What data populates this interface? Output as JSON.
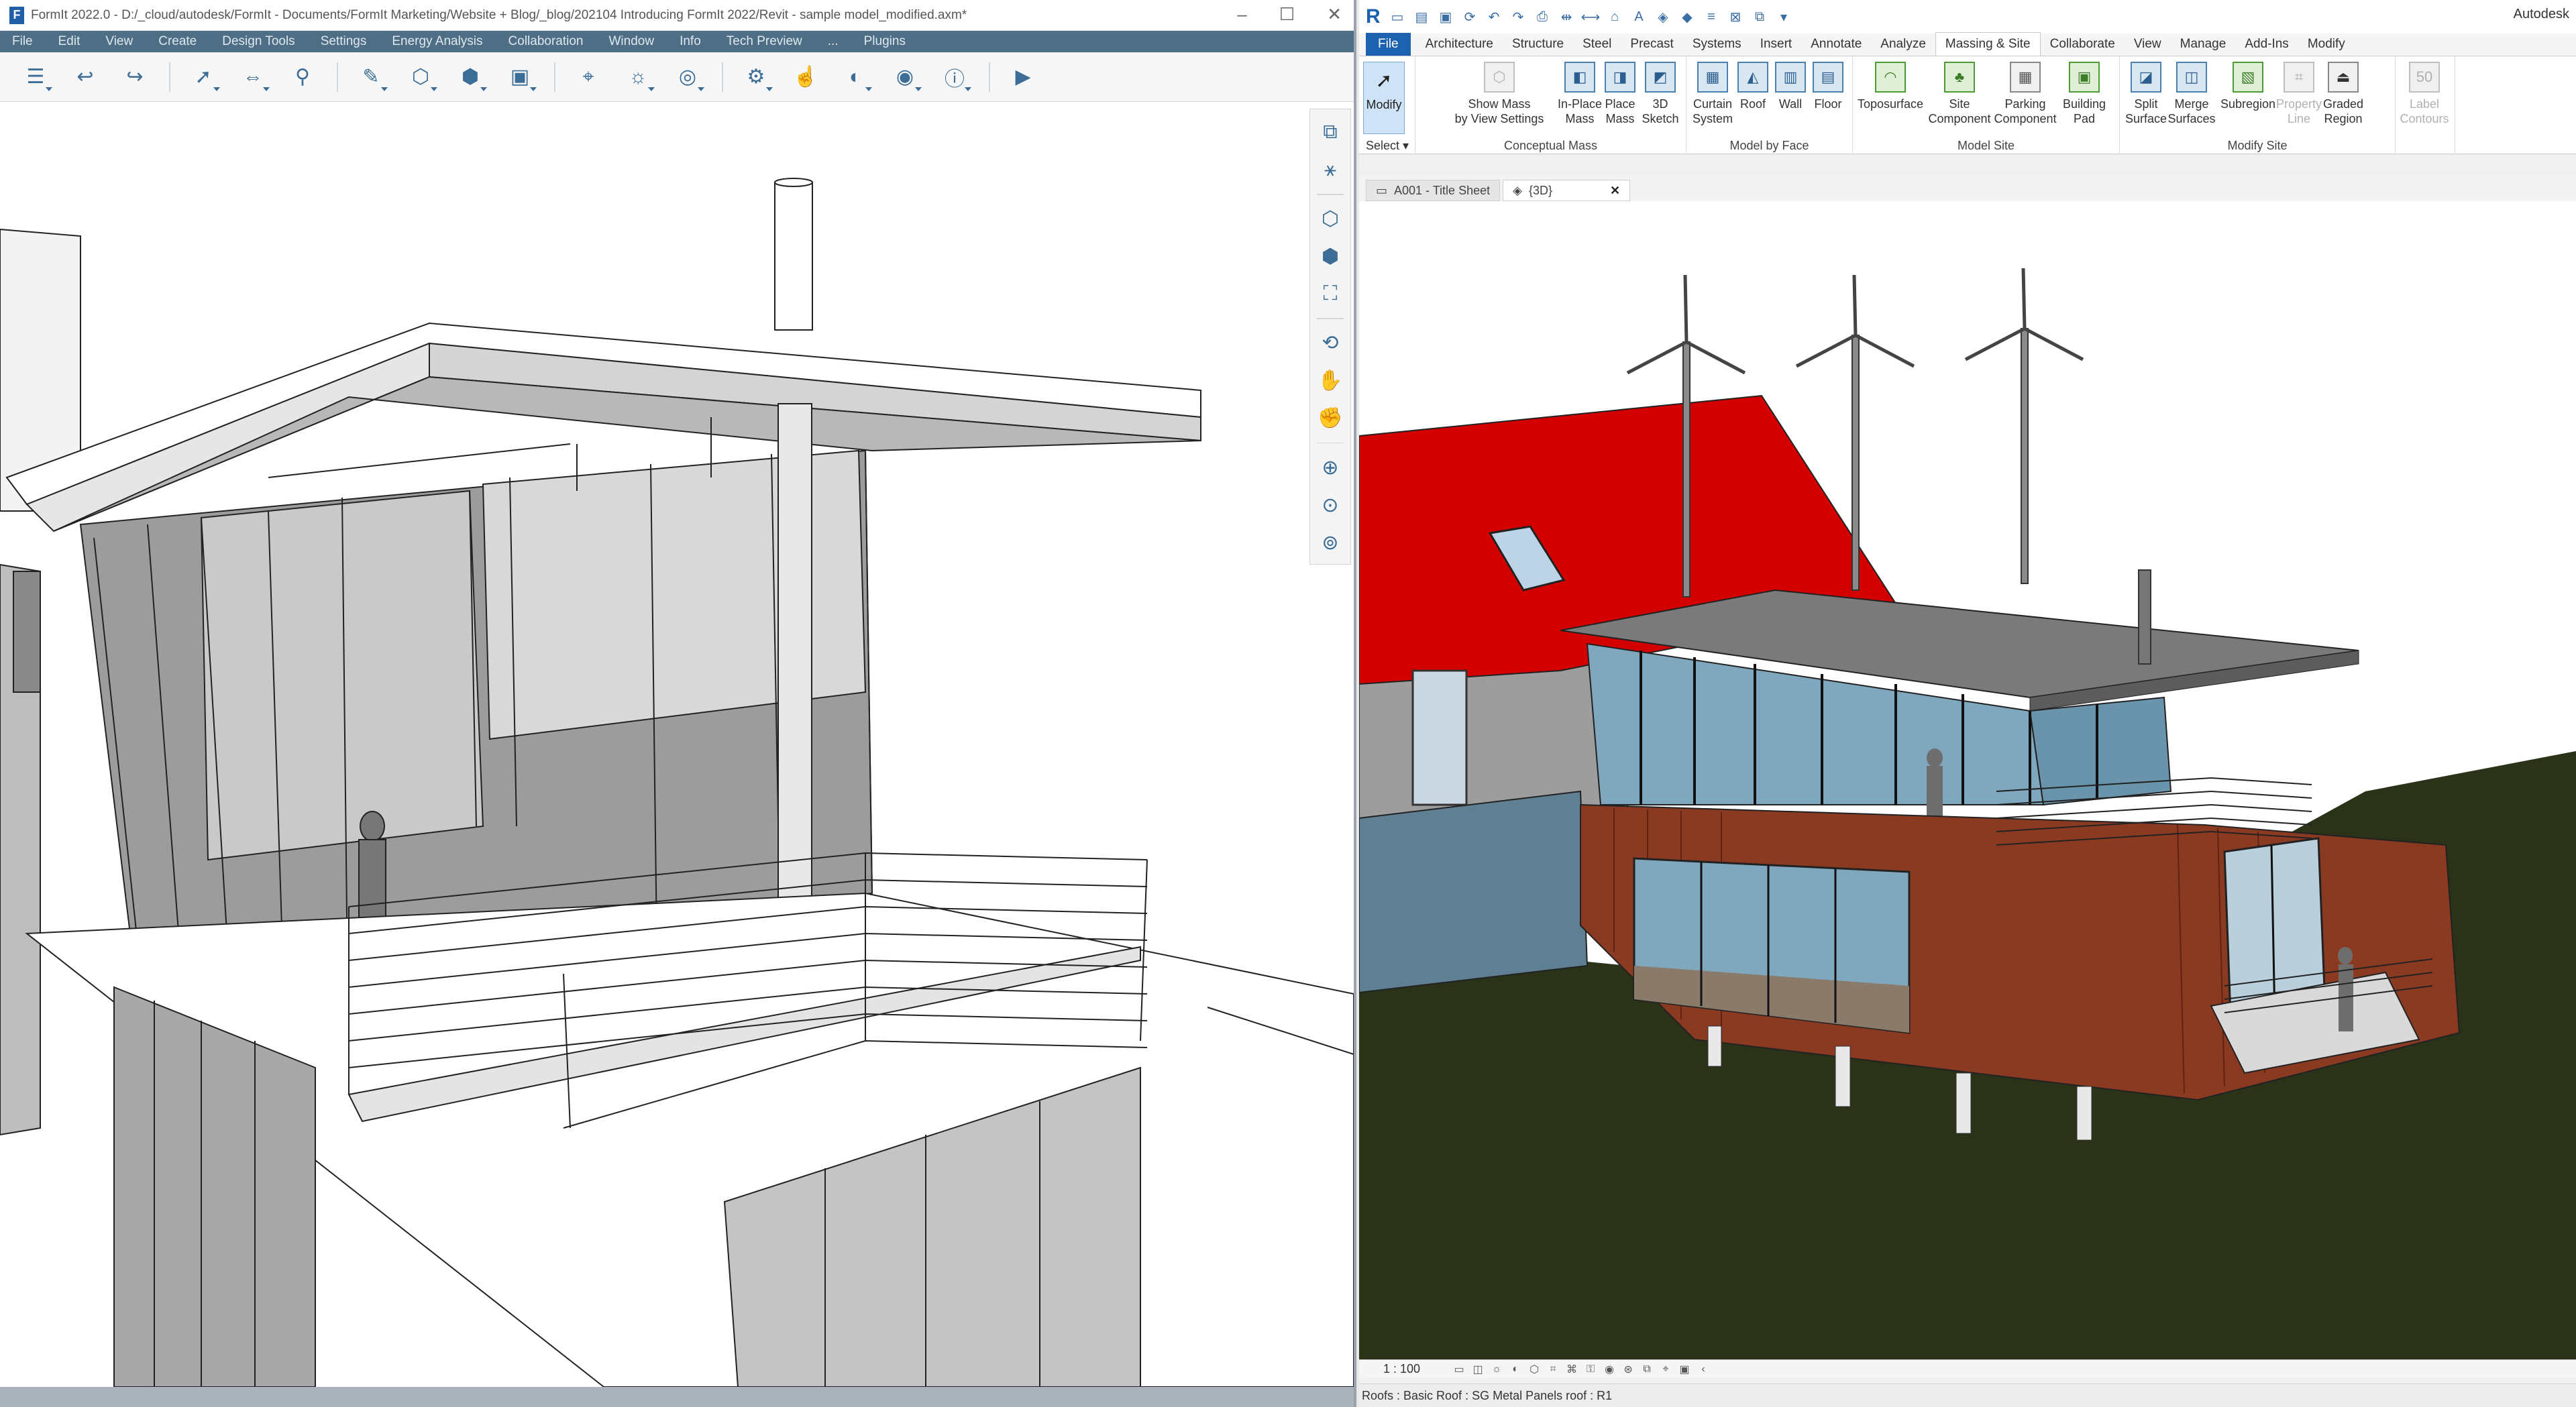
{
  "formit": {
    "title": "FormIt 2022.0 - D:/_cloud/autodesk/FormIt - Documents/FormIt Marketing/Website + Blog/_blog/202104 Introducing FormIt 2022/Revit - sample model_modified.axm*",
    "logo": "F",
    "window_controls": [
      "–",
      "☐",
      "✕"
    ],
    "menu": [
      "File",
      "Edit",
      "View",
      "Create",
      "Design Tools",
      "Settings",
      "Energy Analysis",
      "Collaboration",
      "Window",
      "Info",
      "Tech Preview",
      "...",
      "Plugins"
    ],
    "toolbar_icons": [
      "layers-icon",
      "undo-icon",
      "redo-icon",
      "select-icon",
      "measure-icon",
      "paint-icon",
      "sketch-icon",
      "cube-icon",
      "model-icon",
      "group-icon",
      "location-icon",
      "sun-icon",
      "scale-icon",
      "settings-icon",
      "touch-icon",
      "share-icon",
      "account-icon",
      "info-icon",
      "revit-icon"
    ],
    "nav_icons": [
      "layer-stack-icon",
      "axes-icon",
      "iso-view-icon",
      "top-view-icon",
      "front-view-icon",
      "zoom-extents-icon",
      "orbit-icon",
      "walk-icon",
      "pan-icon",
      "zoom-icon",
      "zoom-window-icon",
      "zoom-selected-icon"
    ]
  },
  "revit": {
    "app_name": "Autodesk",
    "logo": "R",
    "tabs": [
      "File",
      "Architecture",
      "Structure",
      "Steel",
      "Precast",
      "Systems",
      "Insert",
      "Annotate",
      "Analyze",
      "Massing & Site",
      "Collaborate",
      "View",
      "Manage",
      "Add-Ins",
      "Modify"
    ],
    "active_tab": "Massing & Site",
    "modify_label": "Modify",
    "select_label": "Select",
    "groups": {
      "conceptual_mass": "Conceptual Mass",
      "model_by_face": "Model by Face",
      "model_site": "Model Site",
      "modify_site": "Modify Site"
    },
    "buttons": {
      "show_mass": "Show Mass",
      "show_mass_line2": "by View Settings",
      "in_place": "In-Place",
      "in_place_line2": "Mass",
      "place": "Place",
      "place_line2": "Mass",
      "sketch_3d": "3D",
      "sketch_3d_line2": "Sketch",
      "curtain": "Curtain",
      "curtain_line2": "System",
      "roof": "Roof",
      "wall": "Wall",
      "floor": "Floor",
      "toposurface": "Toposurface",
      "site": "Site",
      "site_line2": "Component",
      "parking": "Parking",
      "parking_line2": "Component",
      "building": "Building",
      "building_line2": "Pad",
      "split": "Split",
      "split_line2": "Surface",
      "merge": "Merge",
      "merge_line2": "Surfaces",
      "subregion": "Subregion",
      "property": "Property",
      "property_line2": "Line",
      "graded": "Graded",
      "graded_line2": "Region",
      "label": "Label",
      "label_line2": "Contours"
    },
    "view_tabs": {
      "sheet": "A001 - Title Sheet",
      "view3d": "{3D}",
      "close": "✕"
    },
    "scale": "1 : 100",
    "status": "Roofs : Basic Roof : SG Metal Panels roof : R1",
    "colors": {
      "roof_red": "#d40000",
      "siding": "#8b3a22",
      "ground": "#2a3218",
      "glass": "#7fa7bd",
      "accent": "#1d62b0"
    }
  }
}
